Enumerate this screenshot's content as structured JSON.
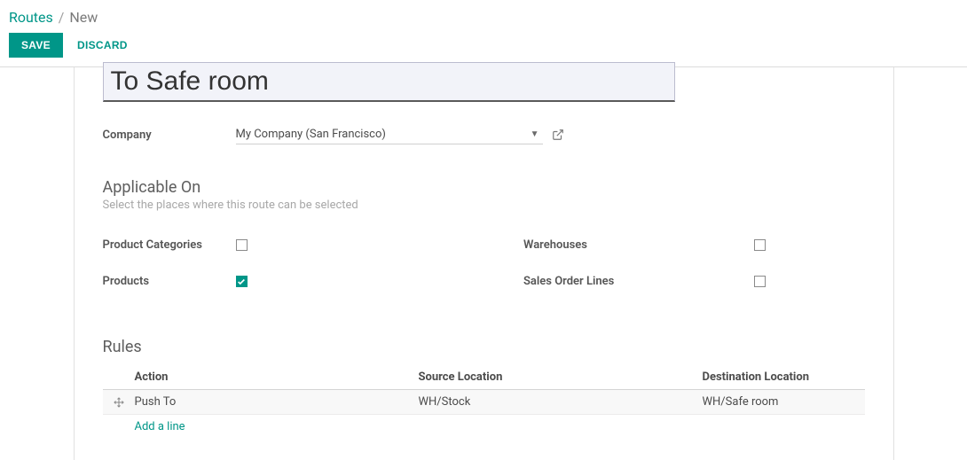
{
  "breadcrumb": {
    "root": "Routes",
    "sep": "/",
    "current": "New"
  },
  "actions": {
    "save": "SAVE",
    "discard": "DISCARD"
  },
  "form": {
    "title": "To Safe room",
    "company": {
      "label": "Company",
      "value": "My Company (San Francisco)"
    },
    "applicable": {
      "heading": "Applicable On",
      "help": "Select the places where this route can be selected",
      "items": {
        "product_categories": {
          "label": "Product Categories",
          "checked": false
        },
        "products": {
          "label": "Products",
          "checked": true
        },
        "warehouses": {
          "label": "Warehouses",
          "checked": false
        },
        "sales_order_lines": {
          "label": "Sales Order Lines",
          "checked": false
        }
      }
    },
    "rules": {
      "heading": "Rules",
      "columns": {
        "action": "Action",
        "source": "Source Location",
        "dest": "Destination Location"
      },
      "rows": [
        {
          "action": "Push To",
          "source": "WH/Stock",
          "dest": "WH/Safe room"
        }
      ],
      "add_line": "Add a line"
    }
  }
}
